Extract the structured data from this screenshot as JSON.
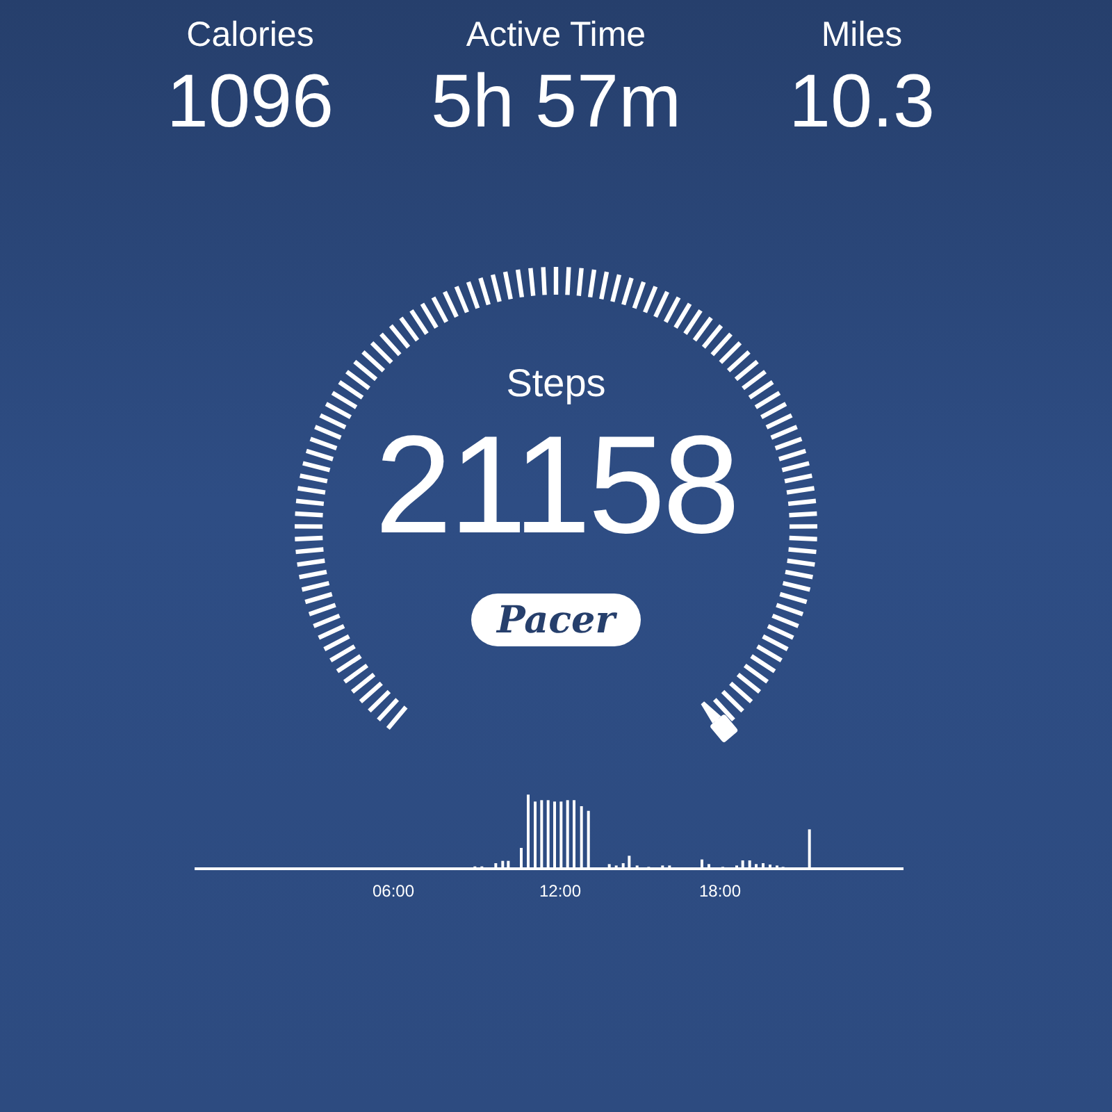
{
  "stats": [
    {
      "label": "Calories",
      "value": "1096"
    },
    {
      "label": "Active Time",
      "value": "5h 57m"
    },
    {
      "label": "Miles",
      "value": "10.3"
    }
  ],
  "gauge": {
    "label": "Steps",
    "value": "21158"
  },
  "brand": "Pacer",
  "timeline": {
    "ticks": [
      "06:00",
      "12:00",
      "18:00"
    ]
  }
}
